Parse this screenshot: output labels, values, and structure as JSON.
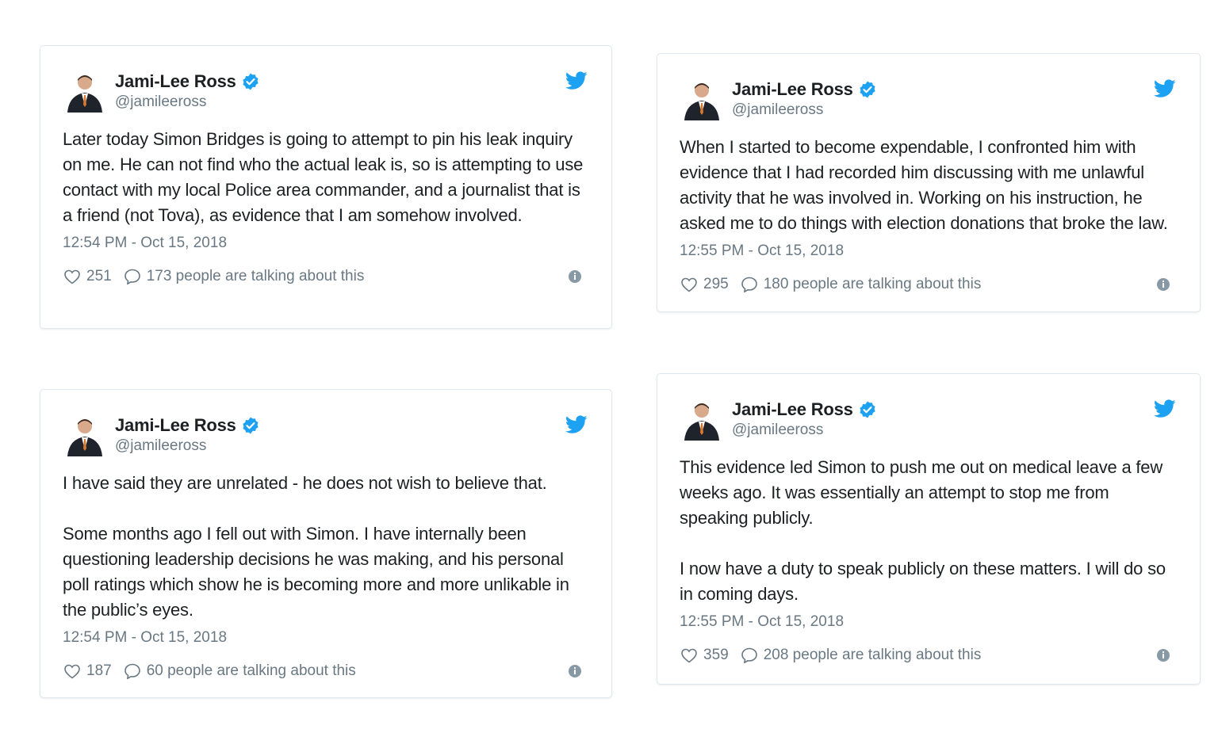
{
  "tweets": [
    {
      "author": "Jami-Lee Ross",
      "handle": "@jamileeross",
      "paragraphs": [
        "Later today Simon Bridges is going to attempt to pin his leak inquiry on me. He can not find who the actual leak is, so is attempting to use contact with my local Police area commander, and a journalist that is a friend (not Tova), as evidence that I am somehow involved."
      ],
      "time": "12:54 PM - Oct 15, 2018",
      "likes": "251",
      "talking": "173 people are talking about this"
    },
    {
      "author": "Jami-Lee Ross",
      "handle": "@jamileeross",
      "paragraphs": [
        "When I started to become expendable, I confronted him with evidence that I had recorded him discussing with me unlawful activity that he was involved in. Working on his instruction, he asked me to do things with election donations that broke the law."
      ],
      "time": "12:55 PM - Oct 15, 2018",
      "likes": "295",
      "talking": "180 people are talking about this"
    },
    {
      "author": "Jami-Lee Ross",
      "handle": "@jamileeross",
      "paragraphs": [
        "I have said they are unrelated - he does not wish to believe that.",
        "Some months ago I fell out with Simon. I have internally been questioning leadership decisions he was making, and his personal poll ratings which show he is becoming more and more unlikable in the public’s eyes."
      ],
      "time": "12:54 PM - Oct 15, 2018",
      "likes": "187",
      "talking": "60 people are talking about this"
    },
    {
      "author": "Jami-Lee Ross",
      "handle": "@jamileeross",
      "paragraphs": [
        "This evidence led Simon to push me out on medical leave a few weeks ago. It was essentially an attempt to stop me from speaking publicly.",
        "I now have a duty to speak publicly on these matters. I will do so in coming days."
      ],
      "time": "12:55 PM - Oct 15, 2018",
      "likes": "359",
      "talking": "208 people are talking about this"
    }
  ],
  "colors": {
    "twitter_blue": "#1da1f2",
    "text": "#1c2022",
    "muted": "#697882",
    "border": "#e1e8ed"
  },
  "icons": [
    "avatar",
    "verified-badge-icon",
    "twitter-bird-icon",
    "heart-icon",
    "reply-bubble-icon",
    "info-icon"
  ]
}
